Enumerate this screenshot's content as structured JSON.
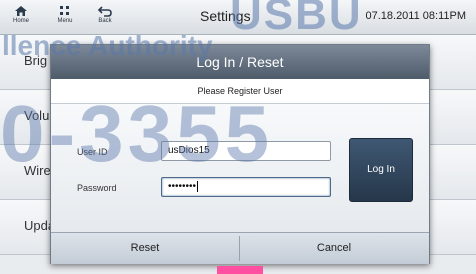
{
  "header": {
    "title": "Settings",
    "datetime": "07.18.2011 08:11PM",
    "nav": [
      {
        "label": "Home",
        "icon": "home-icon"
      },
      {
        "label": "Menu",
        "icon": "menu-grid-icon"
      },
      {
        "label": "Back",
        "icon": "back-arrow-icon"
      }
    ]
  },
  "background_list": {
    "items": [
      "Brig",
      "Volu",
      "Wire",
      "Upda"
    ]
  },
  "watermark": {
    "line1": "USBU",
    "line2": "llence Authority",
    "line3": "0-3355"
  },
  "dialog": {
    "title": "Log In / Reset",
    "subtitle": "Please Register User",
    "user_id_label": "User ID",
    "user_id_value": "usDios15",
    "password_label": "Password",
    "password_value": "••••••••",
    "login_label": "Log In",
    "reset_label": "Reset",
    "cancel_label": "Cancel"
  },
  "colors": {
    "dialog_header": "#5e6b7a",
    "login_button": "#2f445b",
    "accent_pink": "#ff4fa0"
  }
}
